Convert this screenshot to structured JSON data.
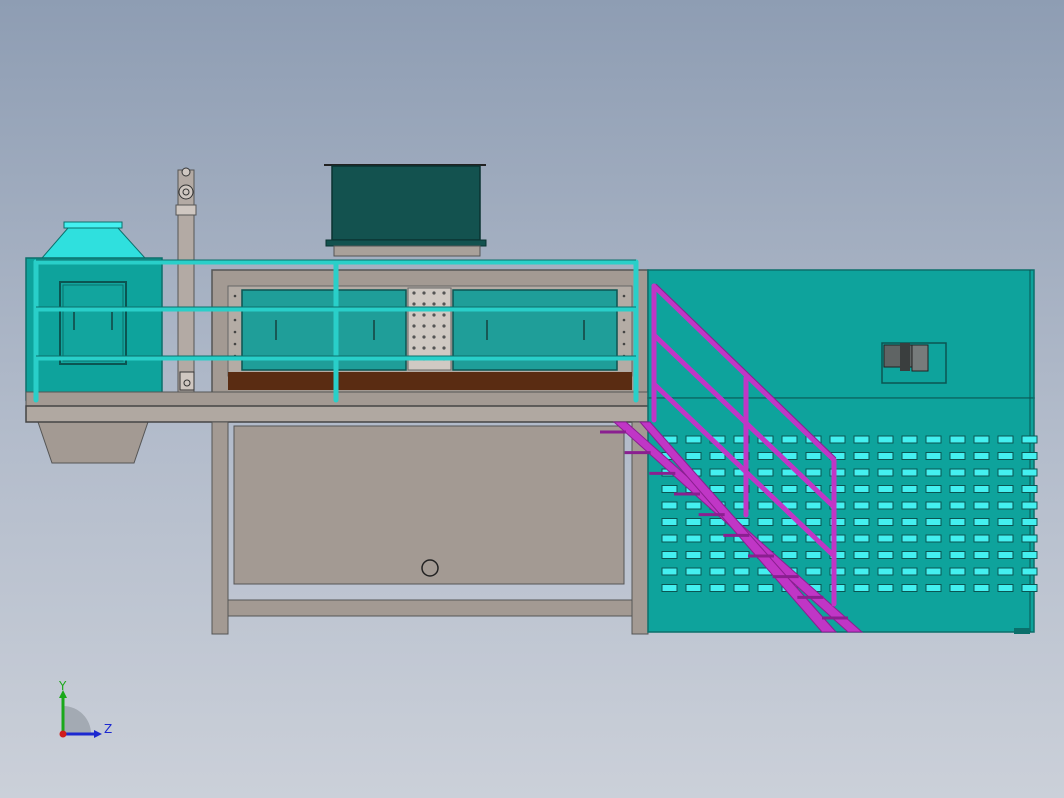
{
  "viewport": {
    "background_top": "#8e9db3",
    "background_bottom": "#cbd0d9"
  },
  "colors": {
    "teal": "#0ea39c",
    "teal_dark": "#0b6f6b",
    "teal_light": "#29cfc9",
    "cyan_highlight": "#44f0f0",
    "dark_green_box": "#13524f",
    "gray_frame": "#a09890",
    "gray_frame_dark": "#5f5a56",
    "rust_band": "#5a2c12",
    "magenta": "#c036c6",
    "magenta_dark": "#8a1f90"
  },
  "triad": {
    "y_label": "Y",
    "z_label": "Z",
    "y_color": "#1aa81a",
    "z_color": "#1c28d0",
    "origin_color": "#d01c1c"
  }
}
